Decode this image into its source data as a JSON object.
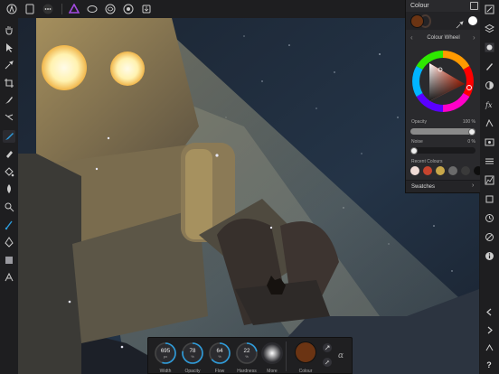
{
  "colour_panel": {
    "title": "Colour",
    "mode": "Colour Wheel",
    "opacity_label": "Opacity",
    "opacity_value": "100 %",
    "opacity_fraction": 1.0,
    "noise_label": "Noise",
    "noise_value": "0 %",
    "noise_fraction": 0.0,
    "recent_label": "Recent Colours",
    "recent_colours": [
      "#f0dcd6",
      "#c7442e",
      "#c9a84a",
      "#6b6b6b",
      "#3a3a3a",
      "#0e0e0e"
    ],
    "swatches_label": "Swatches",
    "current_fill": "#6b3413"
  },
  "context_toolbar": {
    "dials": [
      {
        "value": "695",
        "unit": "px",
        "label": "Width",
        "fraction": 0.55
      },
      {
        "value": "78",
        "unit": "%",
        "label": "Opacity",
        "fraction": 0.78
      },
      {
        "value": "64",
        "unit": "%",
        "label": "Flow",
        "fraction": 0.64
      },
      {
        "value": "22",
        "unit": "%",
        "label": "Hardness",
        "fraction": 0.22
      }
    ],
    "more_label": "More",
    "colour_label": "Colour",
    "alpha_glyph": "α"
  },
  "help_glyph": "?",
  "accent_color": "#2d9cdb",
  "persona_color": "#a34be0"
}
